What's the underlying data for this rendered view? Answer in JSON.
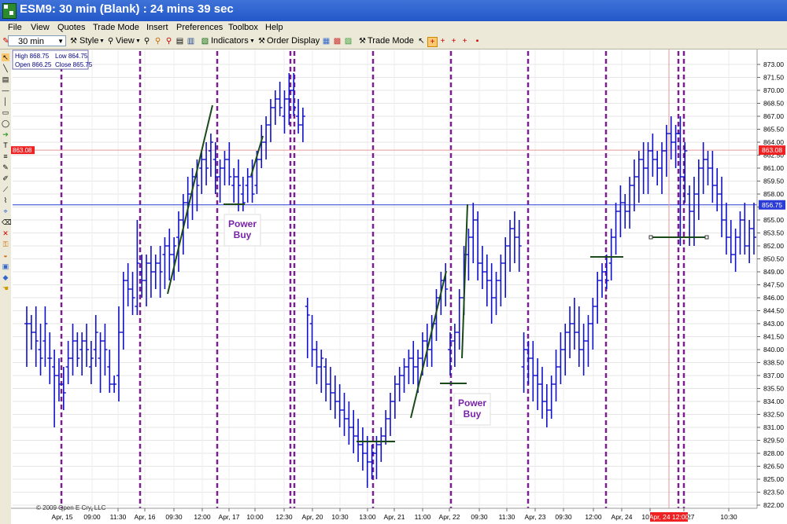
{
  "window": {
    "title": "ESM9: 30 min (Blank) : 24 mins 39 sec"
  },
  "menu": [
    "File",
    "View",
    "Quotes",
    "Trade Mode",
    "Insert",
    "Preferences",
    "Toolbox",
    "Help"
  ],
  "toolbar": {
    "interval": "30 min",
    "style_label": "Style",
    "view_label": "View",
    "indicators_label": "Indicators",
    "order_display_label": "Order Display",
    "trade_mode_label": "Trade Mode"
  },
  "ohlc_box": {
    "high": "High 868.75",
    "low": "Low 864.75",
    "open": "Open 866.25",
    "close": "Close 865.75"
  },
  "copyright": "© 2009 Open E Cry, LLC",
  "price_axis": {
    "labels": [
      "873.00",
      "871.50",
      "870.00",
      "868.50",
      "867.00",
      "865.50",
      "864.00",
      "862.50",
      "861.00",
      "859.50",
      "858.00",
      "856.50",
      "855.00",
      "853.50",
      "852.00",
      "850.50",
      "849.00",
      "847.50",
      "846.00",
      "844.50",
      "843.00",
      "841.50",
      "840.00",
      "838.50",
      "837.00",
      "835.50",
      "834.00",
      "832.50",
      "831.00",
      "829.50",
      "828.00",
      "826.50",
      "825.00",
      "823.50",
      "822.00"
    ],
    "last_price_label": "863.08",
    "blue_line_label": "856.75"
  },
  "time_axis": [
    "Apr, 15",
    "09:00",
    "11:30",
    "Apr, 16",
    "09:30",
    "12:00",
    "Apr, 17",
    "10:00",
    "12:30",
    "Apr, 20",
    "10:30",
    "13:00",
    "Apr, 21",
    "11:00",
    "Apr, 22",
    "09:30",
    "11:30",
    "Apr, 23",
    "09:30",
    "12:00",
    "Apr, 24",
    "10:00",
    "Apr, 27",
    "10:30"
  ],
  "cursor_time_label": "Apr, 24 12:00",
  "annotations": [
    {
      "text_top": "Power",
      "text_bottom": "Buy"
    },
    {
      "text_top": "Power",
      "text_bottom": "Buy"
    }
  ],
  "chart_data": {
    "type": "ohlc-bar",
    "symbol": "ESM9",
    "interval": "30 min",
    "ylim": [
      822,
      874
    ],
    "last_price": 863.08,
    "reference_price": 856.75,
    "session_starts": [
      "Apr, 15",
      "Apr, 16",
      "Apr, 17",
      "Apr, 20",
      "Apr, 21",
      "Apr, 22",
      "Apr, 23",
      "Apr, 24",
      "Apr, 27"
    ],
    "bars": [
      [
        843,
        845,
        838,
        843
      ],
      [
        843,
        844,
        840,
        842
      ],
      [
        842,
        845,
        838,
        841
      ],
      [
        840,
        843,
        837,
        839
      ],
      [
        841,
        845,
        838,
        843
      ],
      [
        839,
        842,
        836,
        839
      ],
      [
        838,
        840,
        831,
        837
      ],
      [
        837,
        839,
        834,
        836
      ],
      [
        836,
        838,
        833,
        835
      ],
      [
        838,
        841,
        836,
        839
      ],
      [
        839,
        843,
        837,
        841
      ],
      [
        841,
        842,
        838,
        839
      ],
      [
        840,
        842,
        837,
        841
      ],
      [
        841,
        843,
        838,
        840
      ],
      [
        838,
        841,
        836,
        839
      ],
      [
        840,
        844,
        838,
        842
      ],
      [
        839,
        842,
        835,
        841
      ],
      [
        841,
        843,
        837,
        840
      ],
      [
        838,
        840,
        835,
        836
      ],
      [
        836,
        837,
        835,
        836
      ],
      [
        837,
        845,
        834,
        842
      ],
      [
        842,
        849,
        840,
        848
      ],
      [
        848,
        850,
        845,
        847
      ],
      [
        847,
        849,
        844,
        846
      ],
      [
        845,
        855,
        844,
        850
      ],
      [
        849,
        851,
        846,
        848
      ],
      [
        848,
        851,
        845,
        850
      ],
      [
        850,
        852,
        846,
        849
      ],
      [
        849,
        851,
        847,
        850
      ],
      [
        850,
        852,
        846,
        849
      ],
      [
        851,
        853,
        847,
        852
      ],
      [
        852,
        854,
        848,
        851
      ],
      [
        851,
        853,
        848,
        852
      ],
      [
        853,
        856,
        849,
        855
      ],
      [
        855,
        858,
        851,
        857
      ],
      [
        857,
        860,
        854,
        858
      ],
      [
        858,
        861,
        855,
        860
      ],
      [
        860,
        862,
        856,
        859
      ],
      [
        861,
        863,
        858,
        862
      ],
      [
        862,
        864,
        859,
        861
      ],
      [
        863,
        865,
        860,
        864
      ],
      [
        862,
        864,
        858,
        860
      ],
      [
        860,
        862,
        857,
        861
      ],
      [
        861,
        863,
        859,
        862
      ],
      [
        862,
        864,
        859,
        860
      ],
      [
        859,
        861,
        857,
        860
      ],
      [
        860,
        862,
        856,
        859
      ],
      [
        858,
        860,
        856,
        857
      ],
      [
        859,
        861,
        857,
        860
      ],
      [
        860,
        862,
        857,
        858
      ],
      [
        859,
        863,
        858,
        862
      ],
      [
        862,
        866,
        861,
        864
      ],
      [
        864,
        867,
        862,
        866
      ],
      [
        866,
        869,
        864,
        868
      ],
      [
        868,
        870,
        866,
        869
      ],
      [
        869,
        871,
        867,
        868
      ],
      [
        867,
        870,
        865,
        869
      ],
      [
        869,
        872,
        866,
        870
      ],
      [
        870,
        872,
        867,
        868
      ],
      [
        867,
        869,
        865,
        866
      ],
      [
        866,
        868,
        864,
        867
      ],
      [
        845,
        846,
        839,
        844
      ],
      [
        843,
        844,
        838,
        840
      ],
      [
        840,
        841,
        836,
        838
      ],
      [
        838,
        840,
        835,
        839
      ],
      [
        838,
        839,
        834,
        836
      ],
      [
        836,
        838,
        833,
        835
      ],
      [
        835,
        837,
        832,
        834
      ],
      [
        834,
        836,
        831,
        833
      ],
      [
        833,
        835,
        830,
        832
      ],
      [
        832,
        834,
        829,
        831
      ],
      [
        831,
        833,
        828,
        830
      ],
      [
        830,
        832,
        827,
        829
      ],
      [
        829,
        831,
        826,
        828
      ],
      [
        828,
        830,
        824,
        827
      ],
      [
        827,
        829,
        825,
        828
      ],
      [
        828,
        830,
        825,
        829
      ],
      [
        829,
        831,
        827,
        830
      ],
      [
        830,
        833,
        829,
        832
      ],
      [
        832,
        835,
        830,
        834
      ],
      [
        834,
        837,
        832,
        836
      ],
      [
        836,
        838,
        834,
        837
      ],
      [
        837,
        839,
        835,
        838
      ],
      [
        838,
        840,
        836,
        839
      ],
      [
        839,
        841,
        836,
        838
      ],
      [
        838,
        840,
        835,
        839
      ],
      [
        839,
        842,
        837,
        841
      ],
      [
        841,
        843,
        838,
        840
      ],
      [
        840,
        844,
        838,
        843
      ],
      [
        843,
        847,
        841,
        846
      ],
      [
        846,
        849,
        844,
        848
      ],
      [
        848,
        850,
        845,
        847
      ],
      [
        840,
        842,
        837,
        841
      ],
      [
        841,
        843,
        838,
        842
      ],
      [
        842,
        847,
        840,
        846
      ],
      [
        846,
        852,
        844,
        851
      ],
      [
        851,
        854,
        848,
        853
      ],
      [
        853,
        857,
        850,
        855
      ],
      [
        855,
        856,
        848,
        850
      ],
      [
        850,
        852,
        847,
        849
      ],
      [
        849,
        851,
        845,
        848
      ],
      [
        848,
        850,
        843,
        846
      ],
      [
        846,
        849,
        844,
        848
      ],
      [
        848,
        851,
        845,
        850
      ],
      [
        850,
        853,
        846,
        852
      ],
      [
        852,
        855,
        849,
        854
      ],
      [
        854,
        856,
        850,
        853
      ],
      [
        853,
        855,
        849,
        852
      ],
      [
        838,
        842,
        835,
        840
      ],
      [
        840,
        841,
        836,
        839
      ],
      [
        839,
        841,
        834,
        837
      ],
      [
        837,
        839,
        833,
        836
      ],
      [
        836,
        838,
        832,
        834
      ],
      [
        834,
        836,
        831,
        833
      ],
      [
        833,
        837,
        832,
        836
      ],
      [
        836,
        840,
        834,
        838
      ],
      [
        838,
        842,
        836,
        840
      ],
      [
        840,
        843,
        837,
        842
      ],
      [
        842,
        845,
        839,
        843
      ],
      [
        843,
        846,
        840,
        842
      ],
      [
        842,
        845,
        838,
        840
      ],
      [
        840,
        843,
        837,
        841
      ],
      [
        841,
        844,
        838,
        843
      ],
      [
        843,
        846,
        840,
        845
      ],
      [
        845,
        849,
        843,
        848
      ],
      [
        848,
        850,
        846,
        849
      ],
      [
        849,
        851,
        847,
        848
      ],
      [
        850,
        854,
        848,
        853
      ],
      [
        853,
        857,
        851,
        856
      ],
      [
        856,
        859,
        853,
        857
      ],
      [
        857,
        858,
        854,
        856
      ],
      [
        856,
        860,
        854,
        859
      ],
      [
        859,
        862,
        856,
        860
      ],
      [
        860,
        863,
        857,
        862
      ],
      [
        862,
        864,
        858,
        861
      ],
      [
        861,
        864,
        858,
        863
      ],
      [
        863,
        865,
        860,
        862
      ],
      [
        862,
        863,
        859,
        861
      ],
      [
        861,
        864,
        858,
        863
      ],
      [
        863,
        866,
        860,
        865
      ],
      [
        865,
        867,
        862,
        864
      ],
      [
        864,
        866,
        861,
        865
      ],
      [
        865,
        867,
        852,
        860
      ],
      [
        860,
        864,
        857,
        863
      ],
      [
        858,
        859,
        852,
        856
      ],
      [
        856,
        860,
        852,
        858
      ],
      [
        858,
        862,
        855,
        861
      ],
      [
        861,
        864,
        858,
        862
      ],
      [
        862,
        863,
        859,
        861
      ],
      [
        861,
        863,
        857,
        859
      ],
      [
        859,
        861,
        856,
        858
      ],
      [
        858,
        860,
        853,
        855
      ],
      [
        855,
        857,
        851,
        853
      ],
      [
        853,
        855,
        850,
        851
      ],
      [
        851,
        854,
        849,
        853
      ],
      [
        853,
        856,
        851,
        855
      ],
      [
        855,
        857,
        851,
        852
      ],
      [
        852,
        855,
        850,
        854
      ],
      [
        854,
        857,
        851,
        853
      ]
    ]
  }
}
